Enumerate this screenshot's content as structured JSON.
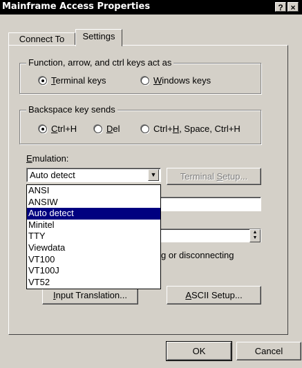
{
  "window": {
    "title": "Mainframe Access Properties",
    "help_btn": "?",
    "close_btn": "×"
  },
  "tabs": [
    {
      "label": "Connect To"
    },
    {
      "label": "Settings"
    }
  ],
  "keys_group": {
    "legend": "Function, arrow, and ctrl keys act as",
    "opt1_u": "T",
    "opt1_rest": "erminal keys",
    "opt2_u": "W",
    "opt2_rest": "indows keys",
    "selected": "Terminal keys"
  },
  "backspace_group": {
    "legend": "Backspace key sends",
    "opt1_u": "C",
    "opt1_rest": "trl+H",
    "opt2_u": "D",
    "opt2_rest": "el",
    "opt3_pre": "Ctrl+",
    "opt3_u": "H",
    "opt3_rest": ", Space, Ctrl+H",
    "selected": "Ctrl+H"
  },
  "emulation": {
    "label_u": "E",
    "label_rest": "mulation:",
    "value": "Auto detect",
    "options": [
      "ANSI",
      "ANSIW",
      "Auto detect",
      "Minitel",
      "TTY",
      "Viewdata",
      "VT100",
      "VT100J",
      "VT52"
    ],
    "selected": "Auto detect"
  },
  "buttons": {
    "terminal_setup_pre": "Terminal ",
    "terminal_setup_u": "S",
    "terminal_setup_rest": "etup...",
    "input_translation_u": "I",
    "input_translation_rest": "nput Translation...",
    "ascii_setup_u": "A",
    "ascii_setup_rest": "SCII Setup...",
    "ok": "OK",
    "cancel": "Cancel"
  },
  "partial_text": {
    "connecting": "g or disconnecting"
  }
}
